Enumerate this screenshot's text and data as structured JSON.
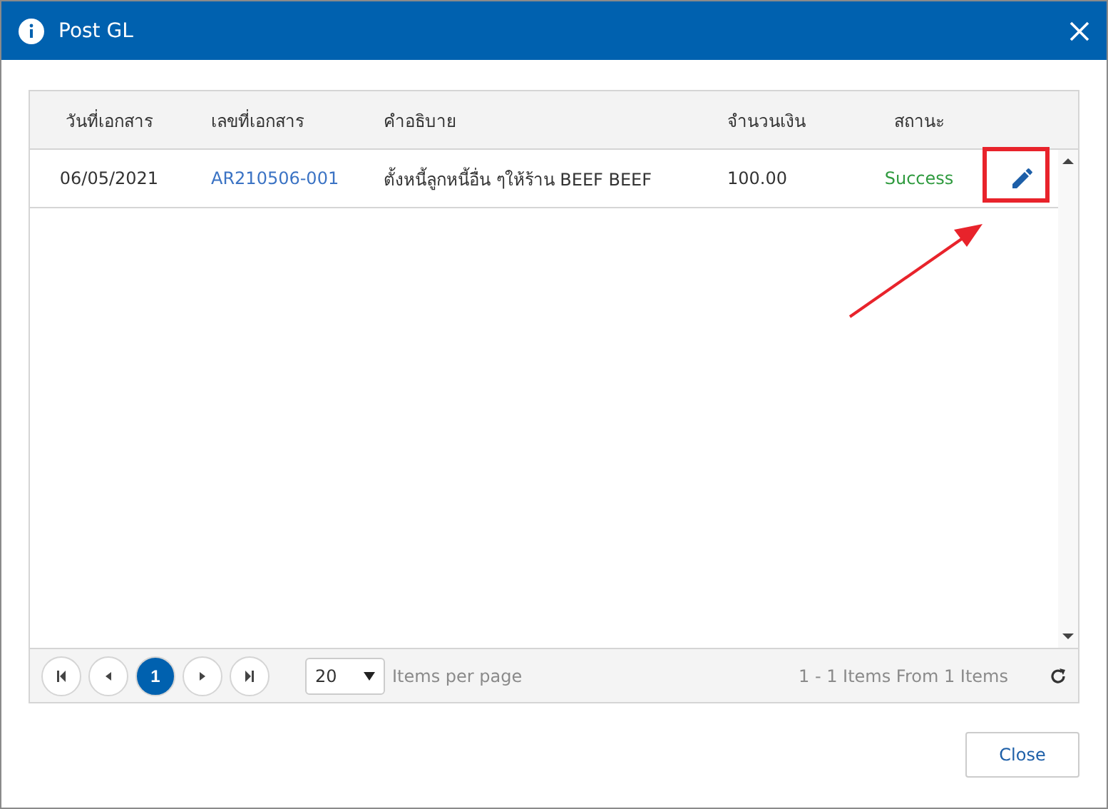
{
  "window": {
    "title": "Post GL"
  },
  "table": {
    "columns": [
      "วันที่เอกสาร",
      "เลขที่เอกสาร",
      "คำอธิบาย",
      "จำนวนเงิน",
      "สถานะ"
    ],
    "rows": [
      {
        "date": "06/05/2021",
        "doc_no": "AR210506-001",
        "description": "ตั้งหนี้ลูกหนี้อื่น ๆให้ร้าน BEEF BEEF",
        "amount": "100.00",
        "status": "Success"
      }
    ]
  },
  "pager": {
    "pages": [
      {
        "label": "1",
        "selected": true
      }
    ],
    "page_size": "20",
    "page_size_label": "Items per page",
    "summary": "1 - 1 Items From 1 Items"
  },
  "buttons": [
    "Close"
  ]
}
